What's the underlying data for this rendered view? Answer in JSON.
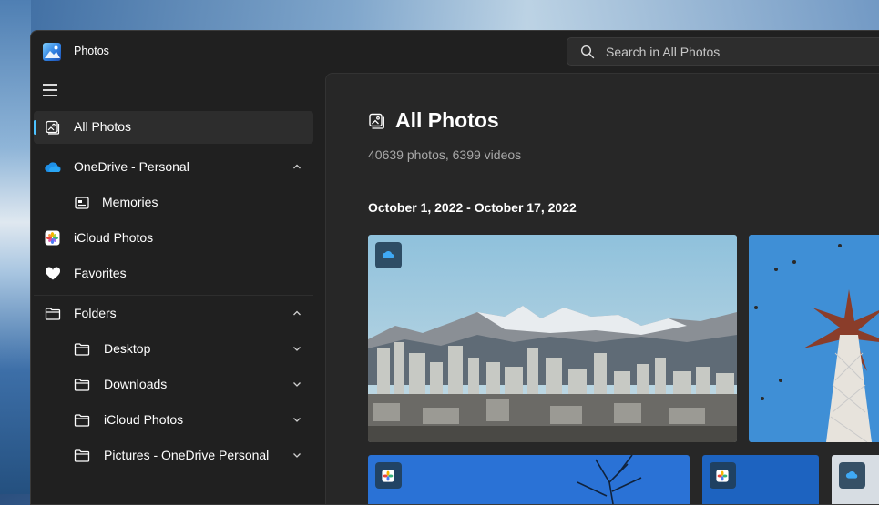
{
  "app": {
    "title": "Photos"
  },
  "search": {
    "placeholder": "Search in All Photos"
  },
  "sidebar": {
    "items": [
      {
        "label": "All Photos",
        "icon": "photo-icon",
        "active": true
      },
      {
        "label": "OneDrive - Personal",
        "icon": "onedrive-cloud-icon",
        "expanded": true
      },
      {
        "label": "Memories",
        "icon": "memories-icon"
      },
      {
        "label": "iCloud Photos",
        "icon": "icloud-photos-icon"
      },
      {
        "label": "Favorites",
        "icon": "heart-icon"
      },
      {
        "label": "Folders",
        "icon": "folder-icon",
        "expanded": true
      },
      {
        "label": "Desktop",
        "icon": "folder-icon"
      },
      {
        "label": "Downloads",
        "icon": "folder-icon"
      },
      {
        "label": "iCloud Photos",
        "icon": "folder-icon"
      },
      {
        "label": "Pictures - OneDrive Personal",
        "icon": "folder-icon"
      }
    ]
  },
  "main": {
    "title": "All Photos",
    "subtitle": "40639 photos, 6399 videos",
    "date_group": "October 1, 2022 - October 17, 2022"
  },
  "colors": {
    "accent": "#4cc2ff",
    "window_bg": "#202020",
    "content_bg": "#272727"
  }
}
